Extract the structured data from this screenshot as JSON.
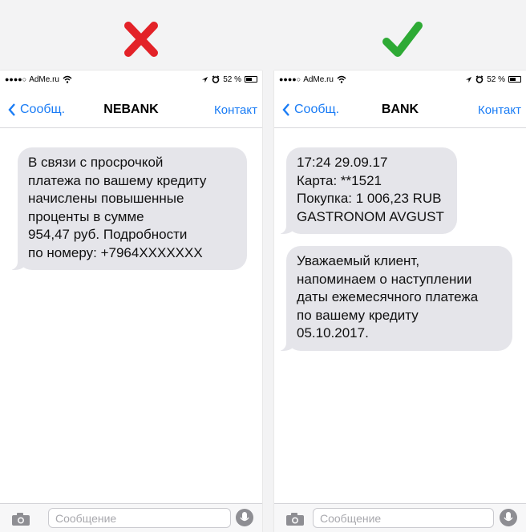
{
  "indicators": {
    "wrong": {
      "icon": "cross-icon",
      "color": "#e32228"
    },
    "right": {
      "icon": "checkmark-icon",
      "color": "#2eaa35"
    }
  },
  "colors": {
    "ios_blue": "#1a7cf5",
    "bubble_gray": "#e5e5ea"
  },
  "status_bar": {
    "signal": "●●●●○",
    "carrier": "AdMe.ru",
    "battery_text": "52 %",
    "battery_level": 0.52
  },
  "phones": [
    {
      "back_label": "Сообщ.",
      "title": "NEBANK",
      "contact_label": "Контакт",
      "messages": [
        "В связи с просрочкой\nплатежа по вашему кредиту\nначислены повышенные\nпроценты в сумме\n954,47 руб. Подробности\nпо номеру: +7964XXXXXXX"
      ],
      "input_placeholder": "Сообщение"
    },
    {
      "back_label": "Сообщ.",
      "title": "BANK",
      "contact_label": "Контакт",
      "messages": [
        "17:24 29.09.17\nКарта: **1521\nПокупка: 1 006,23 RUB\nGASTRONOM AVGUST",
        "Уважаемый клиент,\nнапоминаем о наступлении\nдаты ежемесячного платежа\nпо вашему кредиту\n05.10.2017."
      ],
      "input_placeholder": "Сообщение"
    }
  ]
}
